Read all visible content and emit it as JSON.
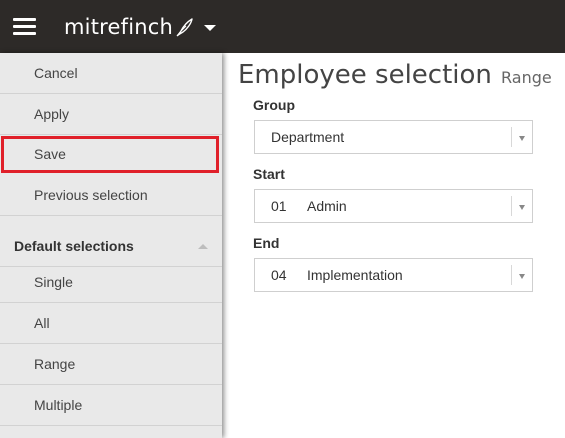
{
  "header": {
    "brand": "mitrefinch",
    "menu_icon": "hamburger-menu-icon",
    "brand_icon": "quill-pen-icon",
    "brand_caret_icon": "caret-down-icon",
    "bar_color": "#2d2a28"
  },
  "sidebar": {
    "actions": [
      {
        "label": "Cancel"
      },
      {
        "label": "Apply"
      },
      {
        "label": "Save"
      },
      {
        "label": "Previous selection"
      }
    ],
    "default_selections": {
      "heading": "Default selections",
      "collapse_icon": "chevron-up-icon",
      "items": [
        {
          "label": "Single"
        },
        {
          "label": "All"
        },
        {
          "label": "Range"
        },
        {
          "label": "Multiple"
        }
      ]
    },
    "highlight_color": "#e0202a"
  },
  "main": {
    "title": "Employee selection",
    "subtitle": "Range",
    "group": {
      "label": "Group",
      "value": "Department"
    },
    "start": {
      "label": "Start",
      "code": "01",
      "value": "Admin"
    },
    "end": {
      "label": "End",
      "code": "04",
      "value": "Implementation"
    }
  }
}
